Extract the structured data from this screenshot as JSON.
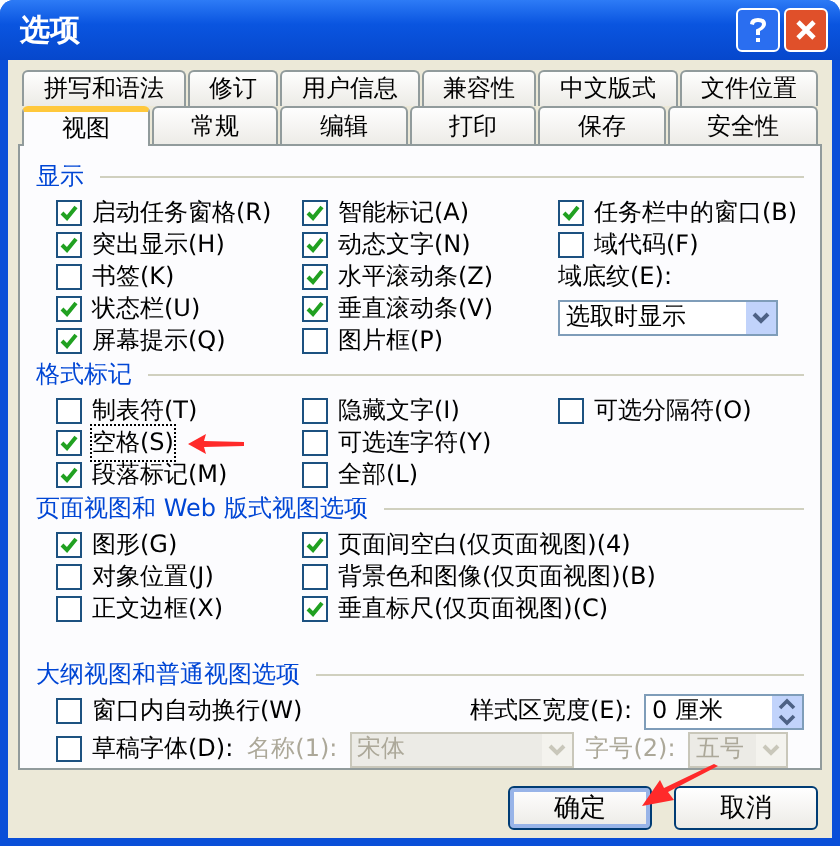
{
  "window": {
    "title": "选项"
  },
  "tabs_back": [
    {
      "label": "拼写和语法",
      "selected": false
    },
    {
      "label": "修订",
      "selected": false
    },
    {
      "label": "用户信息",
      "selected": false
    },
    {
      "label": "兼容性",
      "selected": false
    },
    {
      "label": "中文版式",
      "selected": false
    },
    {
      "label": "文件位置",
      "selected": false
    }
  ],
  "tabs_front": [
    {
      "label": "视图",
      "selected": true
    },
    {
      "label": "常规",
      "selected": false
    },
    {
      "label": "编辑",
      "selected": false
    },
    {
      "label": "打印",
      "selected": false
    },
    {
      "label": "保存",
      "selected": false
    },
    {
      "label": "安全性",
      "selected": false
    }
  ],
  "sections": [
    {
      "title": "显示",
      "kind": "grid",
      "rows": [
        [
          {
            "kind": "checkbox",
            "label": "启动任务窗格(R)",
            "checked": true
          },
          {
            "kind": "checkbox",
            "label": "智能标记(A)",
            "checked": true
          },
          {
            "kind": "checkbox",
            "label": "任务栏中的窗口(B)",
            "checked": true
          }
        ],
        [
          {
            "kind": "checkbox",
            "label": "突出显示(H)",
            "checked": true
          },
          {
            "kind": "checkbox",
            "label": "动态文字(N)",
            "checked": true
          },
          {
            "kind": "checkbox",
            "label": "域代码(F)",
            "checked": false
          }
        ],
        [
          {
            "kind": "checkbox",
            "label": "书签(K)",
            "checked": false
          },
          {
            "kind": "checkbox",
            "label": "水平滚动条(Z)",
            "checked": true
          },
          {
            "kind": "label",
            "label": "域底纹(E):"
          }
        ],
        [
          {
            "kind": "checkbox",
            "label": "状态栏(U)",
            "checked": true
          },
          {
            "kind": "checkbox",
            "label": "垂直滚动条(V)",
            "checked": true
          },
          {
            "kind": "select",
            "value": "选取时显示",
            "disabled": false
          }
        ],
        [
          {
            "kind": "checkbox",
            "label": "屏幕提示(Q)",
            "checked": true
          },
          {
            "kind": "checkbox",
            "label": "图片框(P)",
            "checked": false
          }
        ]
      ]
    },
    {
      "title": "格式标记",
      "kind": "grid",
      "rows": [
        [
          {
            "kind": "checkbox",
            "label": "制表符(T)",
            "checked": false
          },
          {
            "kind": "checkbox",
            "label": "隐藏文字(I)",
            "checked": false
          },
          {
            "kind": "checkbox",
            "label": "可选分隔符(O)",
            "checked": false
          }
        ],
        [
          {
            "kind": "checkbox",
            "label": "空格(S)",
            "checked": true,
            "focused": true,
            "pointer": true
          },
          {
            "kind": "checkbox",
            "label": "可选连字符(Y)",
            "checked": false
          }
        ],
        [
          {
            "kind": "checkbox",
            "label": "段落标记(M)",
            "checked": true
          },
          {
            "kind": "checkbox",
            "label": "全部(L)",
            "checked": false
          }
        ]
      ]
    },
    {
      "title": "页面视图和 Web 版式视图选项",
      "kind": "grid",
      "rows": [
        [
          {
            "kind": "checkbox",
            "label": "图形(G)",
            "checked": true
          },
          {
            "kind": "checkbox",
            "label": "页面间空白(仅页面视图)(4)",
            "checked": true
          }
        ],
        [
          {
            "kind": "checkbox",
            "label": "对象位置(J)",
            "checked": false
          },
          {
            "kind": "checkbox",
            "label": "背景色和图像(仅页面视图)(B)",
            "checked": false
          }
        ],
        [
          {
            "kind": "checkbox",
            "label": "正文边框(X)",
            "checked": false
          },
          {
            "kind": "checkbox",
            "label": "垂直标尺(仅页面视图)(C)",
            "checked": true
          }
        ]
      ]
    },
    {
      "title": "大纲视图和普通视图选项",
      "kind": "flow",
      "lines": [
        {
          "fields": [
            {
              "kind": "checkbox",
              "label": "窗口内自动换行(W)",
              "checked": false
            },
            {
              "kind": "label",
              "label": "样式区宽度(E):",
              "disabled": false
            },
            {
              "kind": "spinner",
              "value": "0 厘米"
            }
          ]
        },
        {
          "fields": [
            {
              "kind": "checkbox",
              "label": "草稿字体(D):",
              "checked": false
            },
            {
              "kind": "label",
              "label": "名称(1):",
              "disabled": true
            },
            {
              "kind": "select",
              "value": "宋体",
              "disabled": true
            },
            {
              "kind": "label",
              "label": "字号(2):",
              "disabled": true
            },
            {
              "kind": "select",
              "value": "五号",
              "disabled": true
            }
          ]
        }
      ]
    }
  ],
  "buttons": [
    {
      "label": "确定",
      "default": true,
      "pointer": true
    },
    {
      "label": "取消",
      "default": false
    }
  ]
}
